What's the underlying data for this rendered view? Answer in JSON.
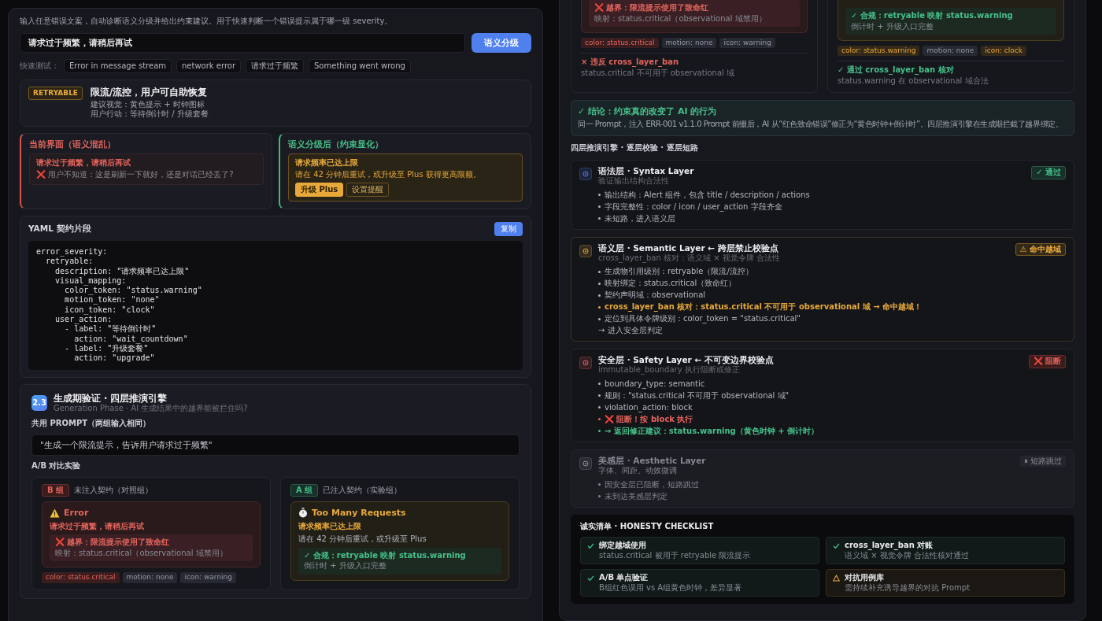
{
  "left": {
    "intro": "输入任意错误文案，自动诊断语义分级并给出约束建议。用于快速判断一个错误提示属于哪一级 severity。",
    "input_value": "请求过于频繁，请稍后再试",
    "submit": "语义分级",
    "quick_label": "快速测试：",
    "quick_tests": [
      "Error in message stream",
      "network error",
      "请求过于频繁",
      "Something went wrong"
    ],
    "result": {
      "badge": "RETRYABLE",
      "title": "限流/流控，用户可自助恢复",
      "lines": [
        "建议视觉：黄色提示 + 时钟图标",
        "用户行动：等待倒计时 / 升级套餐"
      ]
    },
    "compare": [
      {
        "kind": "before",
        "heading": "当前界面（语义混乱）",
        "alert_title": "请求过于频繁，请稍后再试",
        "alert_note": "❌ 用户不知道：这是刷新一下就好，还是对话已经丢了?"
      },
      {
        "kind": "after",
        "heading": "语义分级后（约束显化）",
        "alert_title": "请求频率已达上限",
        "alert_note": "请在 42 分钟后重试，或升级至 Plus 获得更高限额。",
        "actions": [
          {
            "label": "升级 Plus",
            "primary": true
          },
          {
            "label": "设置提醒",
            "primary": false
          }
        ]
      }
    ],
    "yaml": {
      "title": "YAML 契约片段",
      "copy": "复制",
      "code": "error_severity:\n  retryable:\n    description: \"请求频率已达上限\"\n    visual_mapping:\n      color_token: \"status.warning\"\n      motion_token: \"none\"\n      icon_token: \"clock\"\n    user_action:\n      - label: \"等待倒计时\"\n        action: \"wait_countdown\"\n      - label: \"升级套餐\"\n        action: \"upgrade\""
    },
    "phase": {
      "number": "2.3",
      "title": "生成期验证 · 四层推演引擎",
      "subtitle": "Generation Phase · AI 生成结果中的越界能被拦住吗?",
      "prompt_label": "共用 PROMPT（两组输入相同）",
      "prompt": "\"生成一个限流提示，告诉用户请求过于频繁\"",
      "ab_label": "A/B 对比实验",
      "groups": [
        {
          "kind": "violation",
          "tag": "B 组",
          "caption": "未注入契约（对照组）",
          "title": "Error",
          "message": "请求过于频繁，请稍后再试",
          "check": {
            "title": "❌ 越界：限流提示使用了致命红",
            "note": "映射：status.critical（observational 域禁用）"
          },
          "tags": [
            {
              "text": "color: status.critical",
              "kind": "danger"
            },
            {
              "text": "motion: none",
              "kind": "neutral"
            },
            {
              "text": "icon: warning",
              "kind": "neutral"
            }
          ]
        },
        {
          "kind": "compliant",
          "tag": "A 组",
          "caption": "已注入契约（实验组）",
          "title": "Too Many Requests",
          "message": "请求频率已达上限",
          "body": "请在 42 分钟后重试，或升级至 Plus",
          "check": {
            "title": "✓ 合规：retryable 映射 status.warning",
            "note": "倒计时 + 升级入口完整"
          }
        }
      ]
    }
  },
  "right": {
    "groups": [
      {
        "kind": "violation",
        "check": {
          "title": "❌ 越界：限流提示使用了致命红",
          "note": "映射：status.critical（observational 域禁用）"
        },
        "tags": [
          {
            "text": "color: status.critical",
            "kind": "danger"
          },
          {
            "text": "motion: none",
            "kind": "neutral"
          },
          {
            "text": "icon: warning",
            "kind": "neutral"
          }
        ],
        "verdict": {
          "title": "× 违反 cross_layer_ban",
          "note": "status.critical 不可用于 observational 域"
        }
      },
      {
        "kind": "compliant",
        "check": {
          "title": "✓ 合规：retryable 映射 status.warning",
          "note": "倒计时 + 升级入口完整"
        },
        "tags": [
          {
            "text": "color: status.warning",
            "kind": "warning"
          },
          {
            "text": "motion: none",
            "kind": "neutral"
          },
          {
            "text": "icon: clock",
            "kind": "warning"
          }
        ],
        "verdict": {
          "title": "✓ 通过 cross_layer_ban 核对",
          "note": "status.warning 在 observational 域合法"
        }
      }
    ],
    "conclusion": {
      "title": "✓ 结论：约束真的改变了 AI 的行为",
      "text": "同一 Prompt，注入 ERR-001 v1.1.0 Prompt 前缀后，AI 从“红色致命错误”修正为“黄色时钟+倒计时”。四层推演引擎在生成期拦截了越界绑定。"
    },
    "engine": {
      "title": "四层推演引擎 · 逐层校验 · 逐层短路",
      "layers": [
        {
          "kind": "pass",
          "title": "语法层 · Syntax Layer",
          "subtitle": "验证输出结构合法性",
          "badge": "✓ 通过",
          "items": [
            {
              "kind": "bullet",
              "text": "输出结构：Alert 组件，包含 title / description / actions"
            },
            {
              "kind": "bullet",
              "text": "字段完整性：color / icon / user_action 字段齐全"
            },
            {
              "kind": "bullet",
              "text": "未短路，进入语义层"
            }
          ]
        },
        {
          "kind": "hit",
          "title": "语义层 · Semantic Layer ← 跨层禁止校验点",
          "subtitle": "cross_layer_ban 核对：语义域 × 视觉令牌 合法性",
          "badge": "⚠ 命中越域",
          "items": [
            {
              "kind": "bullet",
              "text": "生成物引用级别：retryable（限流/流控）"
            },
            {
              "kind": "bullet",
              "text": "映射绑定：status.critical（致命红）"
            },
            {
              "kind": "bullet",
              "text": "契约声明域：observational"
            },
            {
              "kind": "warn",
              "text": "cross_layer_ban 核对：status.critical 不可用于 observational 域 → 命中越域！"
            },
            {
              "kind": "bullet",
              "text": "定位到具体令牌级别：color_token = \"status.critical\""
            },
            {
              "kind": "step",
              "text": "→ 进入安全层判定"
            }
          ]
        },
        {
          "kind": "block",
          "title": "安全层 · Safety Layer ← 不可变边界校验点",
          "subtitle": "immutable_boundary 执行阻断或修正",
          "badge": "❌ 阻断",
          "items": [
            {
              "kind": "bullet",
              "text": "boundary_type: semantic"
            },
            {
              "kind": "bullet",
              "text": "规则：\"status.critical 不可用于 observational 域\""
            },
            {
              "kind": "bullet",
              "text": "violation_action: block"
            },
            {
              "kind": "danger",
              "text": "❌ 阻断！按 block 执行"
            },
            {
              "kind": "ok",
              "text": "→ 返回修正建议：status.warning（黄色时钟 + 倒计时）"
            }
          ]
        },
        {
          "kind": "skipped",
          "title": "美感层 · Aesthetic Layer",
          "subtitle": "字体、间距、动效微调",
          "badge": "⏸ 短路跳过",
          "items": [
            {
              "kind": "bullet",
              "text": "因安全层已阻断，短路跳过"
            },
            {
              "kind": "bullet",
              "text": "未到达美感层判定"
            }
          ]
        }
      ]
    },
    "checklist": {
      "title": "诚实清单 · HONESTY CHECKLIST",
      "items": [
        {
          "checked": true,
          "title": "绑定越域使用",
          "note": "status.critical 被用于 retryable 限流提示"
        },
        {
          "checked": true,
          "title": "cross_layer_ban 对账",
          "note": "语义域 × 视觉令牌 合法性核对通过"
        },
        {
          "checked": true,
          "title": "A/B 单点验证",
          "note": "B组红色误用 vs A组黄色时钟，差异显著"
        },
        {
          "checked": false,
          "title": "对抗用例库",
          "note": "需持续补充诱导越界的对抗 Prompt"
        }
      ]
    }
  }
}
